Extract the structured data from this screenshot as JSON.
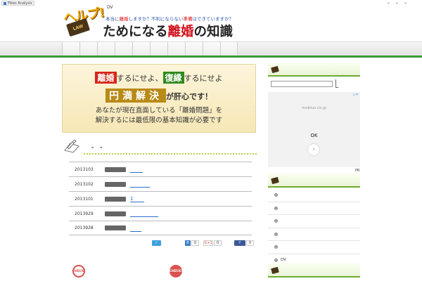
{
  "topbar": {
    "analysis_label": "Pikes Analysis",
    "nav": [
      "»",
      "»",
      "»"
    ]
  },
  "header": {
    "dv_label": "DV",
    "logo_tag": "ヘルプ!",
    "logo_book": "LAW",
    "logo_sub_prefix": "本当に",
    "logo_sub_red": "離婚",
    "logo_sub_mid": "しますか？不利にならない",
    "logo_sub_red2": "準備",
    "logo_sub_suffix": "はできていますか？",
    "logo_main_a": "ためになる",
    "logo_main_red": "離婚",
    "logo_main_b": "の知識"
  },
  "banner": {
    "hl1": "離婚",
    "t1": "するにせよ、",
    "hl2": "復縁",
    "t2": "するにせよ",
    "hl3": "円満解決",
    "t3": "が肝心です！",
    "line3": "あなたが現在直面している「離婚問題」を",
    "line4": "解決するには最低限の基本知識が必要です"
  },
  "post": {
    "title": "- -",
    "rows": [
      {
        "date": "2013103",
        "link": ""
      },
      {
        "date": "2013102",
        "link": ""
      },
      {
        "date": "2013101",
        "link": "1"
      },
      {
        "date": "2013929",
        "link": ""
      },
      {
        "date": "2013928",
        "link": ""
      }
    ]
  },
  "share": {
    "hatena_count": "0",
    "gplus_label": "G+1",
    "gplus_count": "0",
    "fb_count": "0"
  },
  "badges": {
    "check1": "CHECK!",
    "check2": "CHECK!"
  },
  "ad": {
    "domain": "mobius.co.jp",
    "ok": "OK",
    "pr": "PR"
  },
  "sidebar": {
    "items": [
      "",
      "",
      "",
      "",
      "",
      "DV"
    ]
  },
  "colors": {
    "accent_green": "#3a9a3a",
    "title_red": "#d1121c",
    "link_blue": "#2a6ec7"
  }
}
